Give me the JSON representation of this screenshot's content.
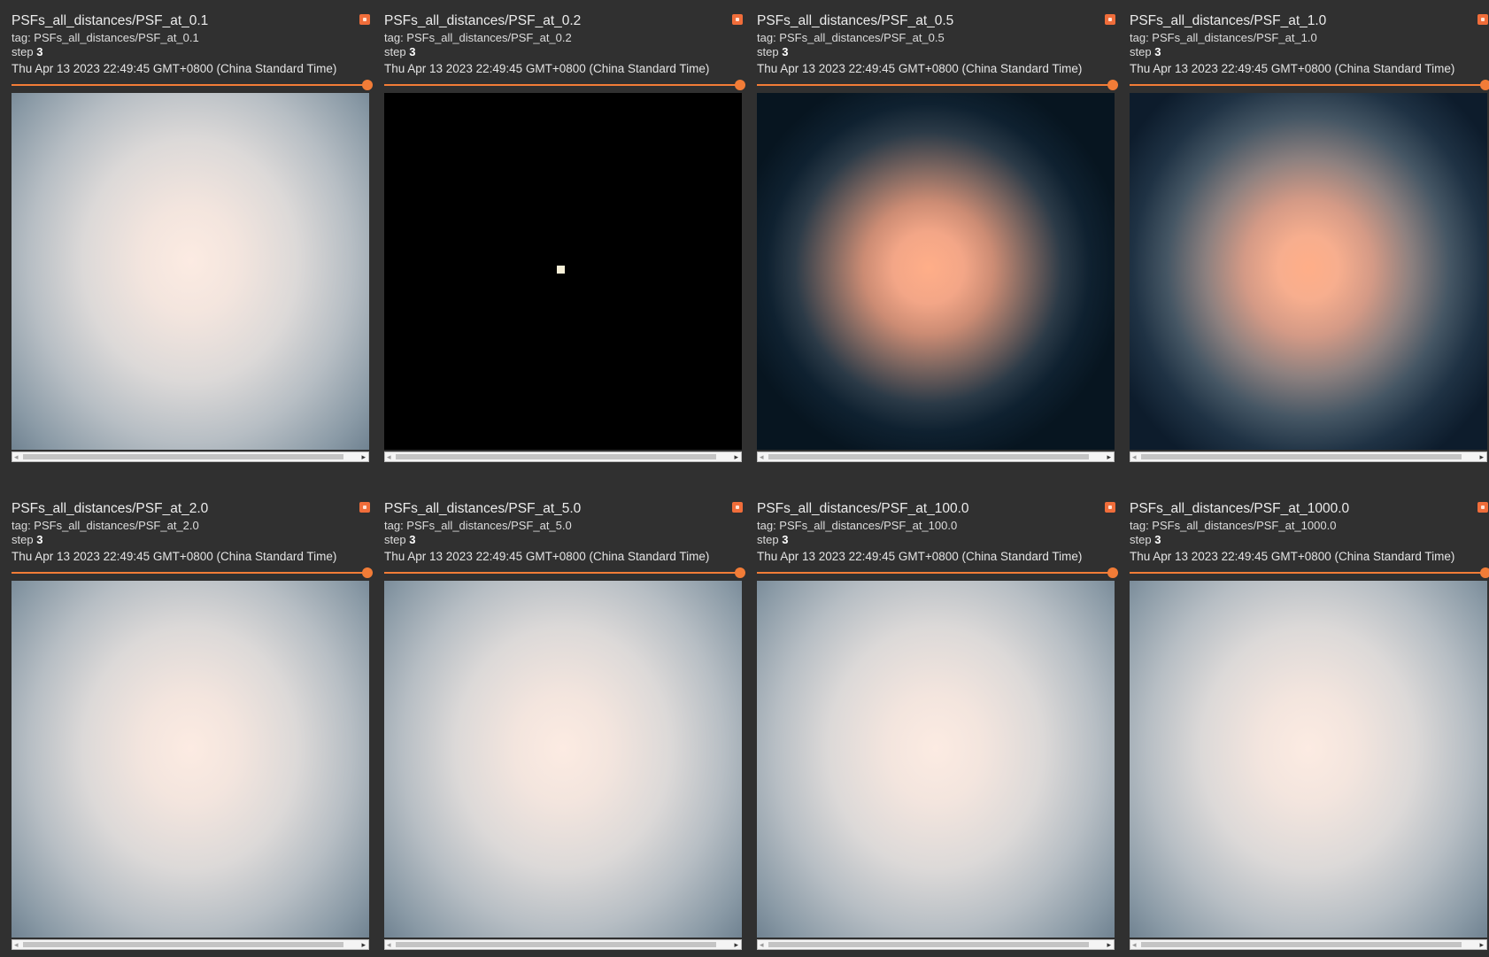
{
  "cards": [
    {
      "title": "PSFs_all_distances/PSF_at_0.1",
      "tag": "tag: PSFs_all_distances/PSF_at_0.1",
      "step_label": "step",
      "step": "3",
      "timestamp": "Thu Apr 13 2023 22:49:45 GMT+0800 (China Standard Time)"
    },
    {
      "title": "PSFs_all_distances/PSF_at_0.2",
      "tag": "tag: PSFs_all_distances/PSF_at_0.2",
      "step_label": "step",
      "step": "3",
      "timestamp": "Thu Apr 13 2023 22:49:45 GMT+0800 (China Standard Time)"
    },
    {
      "title": "PSFs_all_distances/PSF_at_0.5",
      "tag": "tag: PSFs_all_distances/PSF_at_0.5",
      "step_label": "step",
      "step": "3",
      "timestamp": "Thu Apr 13 2023 22:49:45 GMT+0800 (China Standard Time)"
    },
    {
      "title": "PSFs_all_distances/PSF_at_1.0",
      "tag": "tag: PSFs_all_distances/PSF_at_1.0",
      "step_label": "step",
      "step": "3",
      "timestamp": "Thu Apr 13 2023 22:49:45 GMT+0800 (China Standard Time)"
    },
    {
      "title": "PSFs_all_distances/PSF_at_2.0",
      "tag": "tag: PSFs_all_distances/PSF_at_2.0",
      "step_label": "step",
      "step": "3",
      "timestamp": "Thu Apr 13 2023 22:49:45 GMT+0800 (China Standard Time)"
    },
    {
      "title": "PSFs_all_distances/PSF_at_5.0",
      "tag": "tag: PSFs_all_distances/PSF_at_5.0",
      "step_label": "step",
      "step": "3",
      "timestamp": "Thu Apr 13 2023 22:49:45 GMT+0800 (China Standard Time)"
    },
    {
      "title": "PSFs_all_distances/PSF_at_100.0",
      "tag": "tag: PSFs_all_distances/PSF_at_100.0",
      "step_label": "step",
      "step": "3",
      "timestamp": "Thu Apr 13 2023 22:49:45 GMT+0800 (China Standard Time)"
    },
    {
      "title": "PSFs_all_distances/PSF_at_1000.0",
      "tag": "tag: PSFs_all_distances/PSF_at_1000.0",
      "step_label": "step",
      "step": "3",
      "timestamp": "Thu Apr 13 2023 22:49:45 GMT+0800 (China Standard Time)"
    }
  ],
  "icons": {
    "expand": "expand-icon",
    "scroll_left": "chevron-left-icon",
    "scroll_right": "chevron-right-icon"
  },
  "colors": {
    "background": "#303030",
    "accent": "#f27c37",
    "expand_button": "#f06d3a"
  }
}
